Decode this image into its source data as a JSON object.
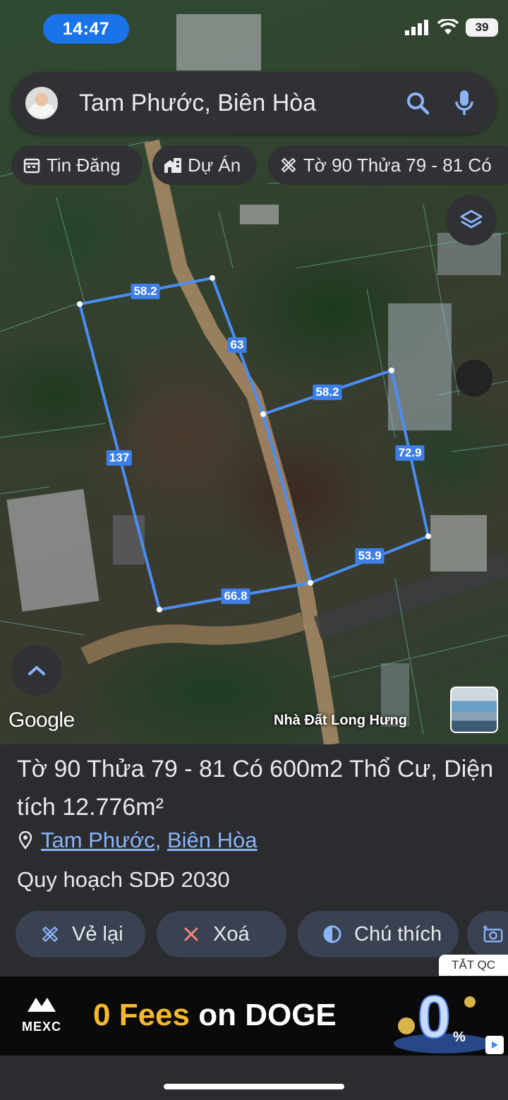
{
  "status": {
    "time": "14:47",
    "battery": "39"
  },
  "search": {
    "query": "Tam Phước, Biên Hòa"
  },
  "chips": [
    {
      "label": "Tin Đăng",
      "icon": "calendar-icon"
    },
    {
      "label": "Dự Án",
      "icon": "buildings-icon"
    },
    {
      "label": "Tờ 90 Thửa 79 - 81 Có",
      "icon": "draw-polygon-icon"
    }
  ],
  "map": {
    "measurements": [
      "58.2",
      "63",
      "137",
      "58.2",
      "72.9",
      "53.9",
      "66.8"
    ],
    "attribution": "Google",
    "watermark": "Nhà Đất Long Hưng",
    "boundary_color": "#4a8ef5",
    "label_color": "#3d7fe8"
  },
  "listing": {
    "title": "Tờ 90 Thửa 79 - 81 Có 600m2 Thổ Cư, Diện tích 12.776m²",
    "location_links": [
      "Tam Phước",
      "Biên Hòa"
    ],
    "separator": ",",
    "plan": "Quy hoạch SDĐ 2030"
  },
  "actions": [
    {
      "label": "Vẻ lại",
      "icon": "draw-icon"
    },
    {
      "label": "Xoá",
      "icon": "close-icon"
    },
    {
      "label": "Chú thích",
      "icon": "contrast-icon"
    }
  ],
  "ad": {
    "close_label": "TẮT QC",
    "brand": "MEXC",
    "headline_a": "0 Fees",
    "headline_b": " on DOGE"
  }
}
